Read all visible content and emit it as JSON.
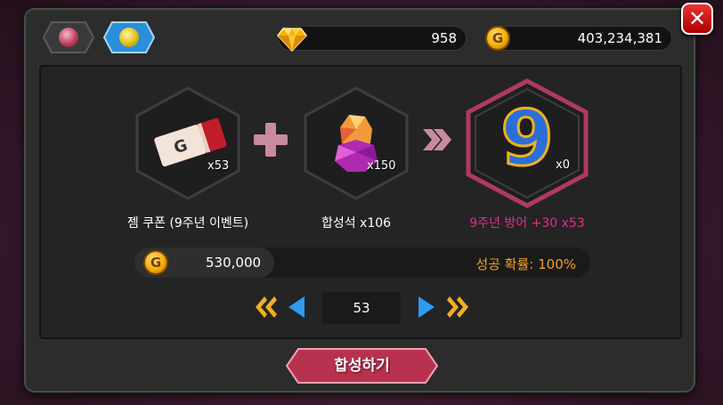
{
  "tabs": [
    {
      "icon": "ruby-gem-icon",
      "active": false
    },
    {
      "icon": "lemon-gem-icon",
      "active": true
    }
  ],
  "currency": {
    "gems": "958",
    "gold": "403,234,381",
    "gem_icon": "diamond-icon",
    "gold_icon": "gold-coin-icon",
    "coin_letter": "G"
  },
  "recipe": {
    "ingredient1": {
      "name": "젬 쿠폰 (9주년 이벤트)",
      "count": "x53",
      "icon": "gem-coupon-ticket-icon",
      "ticket_letter": "G"
    },
    "ingredient2": {
      "name": "합성석 x106",
      "count": "x150",
      "icon": "synthesis-stone-icon"
    },
    "result": {
      "name": "9주년 방어 +30 x53",
      "count": "x0",
      "icon": "number-nine-gem-icon",
      "glyph": "9",
      "name_color": "#e0308a"
    }
  },
  "cost": {
    "price": "530,000",
    "success_rate": "성공 확률: 100%"
  },
  "pager": {
    "value": "53"
  },
  "action": {
    "label": "합성하기"
  },
  "colors": {
    "accent_pink": "#e0308a",
    "rate_orange": "#f0a020",
    "arrow_blue": "#2f9bef",
    "arrow_gold": "#f0b020",
    "button": "#b8324f"
  }
}
